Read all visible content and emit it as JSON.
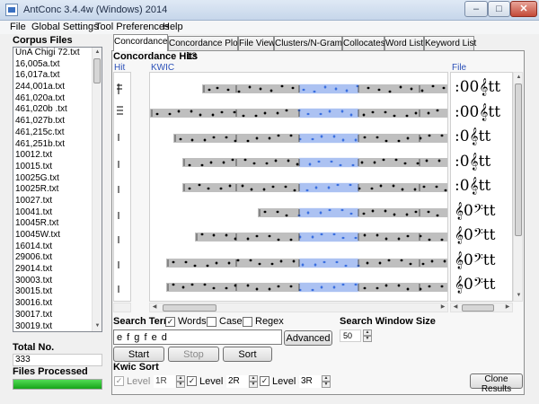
{
  "window": {
    "title": "AntConc 3.4.4w (Windows) 2014"
  },
  "menu": [
    "File",
    "Global Settings",
    "Tool Preferences",
    "Help"
  ],
  "corpus": {
    "title": "Corpus Files",
    "files": [
      "UnA Chigi 72.txt",
      "16,005a.txt",
      "16,017a.txt",
      "244,001a.txt",
      "461,020a.txt",
      "461,020b .txt",
      "461,027b.txt",
      "461,215c.txt",
      "461,251b.txt",
      "10012.txt",
      "10015.txt",
      "10025G.txt",
      "10025R.txt",
      "10027.txt",
      "10041.txt",
      "10045R.txt",
      "10045W.txt",
      "16014.txt",
      "29006.txt",
      "29014.txt",
      "30003.txt",
      "30015.txt",
      "30016.txt",
      "30017.txt",
      "30019.txt"
    ],
    "total_label": "Total No.",
    "total_value": "333",
    "processed_label": "Files Processed",
    "processed_fraction": 1.0
  },
  "tabs": [
    "Concordance",
    "Concordance Plot",
    "File View",
    "Clusters/N-Grams",
    "Collocates",
    "Word List",
    "Keyword List"
  ],
  "active_tab": 0,
  "concordance": {
    "hits_label": "Concordance Hits",
    "hits_count": "13",
    "col_hit": "Hit",
    "col_kwic": "KWIC",
    "col_file": "File",
    "highlight_color": "#3a6fe0",
    "file_glyphs": [
      ":00𝄞tt",
      ":00𝄞tt",
      ":0𝄞tt",
      ":0𝄞tt",
      ":0𝄞tt",
      "𝄞0𝄢tt",
      "𝄞0𝄢tt",
      "𝄞0𝄢tt",
      "𝄞0𝄢tt"
    ]
  },
  "search": {
    "label": "Search Term",
    "words_label": "Words",
    "words_checked": true,
    "case_label": "Case",
    "case_checked": false,
    "regex_label": "Regex",
    "regex_checked": false,
    "value": "e f g f e d",
    "advanced_label": "Advanced",
    "start_label": "Start",
    "stop_label": "Stop",
    "sort_label": "Sort",
    "window_size_label": "Search Window Size",
    "window_size_value": "50"
  },
  "kwic_sort": {
    "label": "Kwic Sort",
    "levels": [
      {
        "label": "Level 1",
        "value": "1R",
        "checked": true,
        "enabled": false
      },
      {
        "label": "Level 2",
        "value": "2R",
        "checked": true,
        "enabled": true
      },
      {
        "label": "Level 3",
        "value": "3R",
        "checked": true,
        "enabled": true
      }
    ],
    "clone_label": "Clone Results"
  }
}
